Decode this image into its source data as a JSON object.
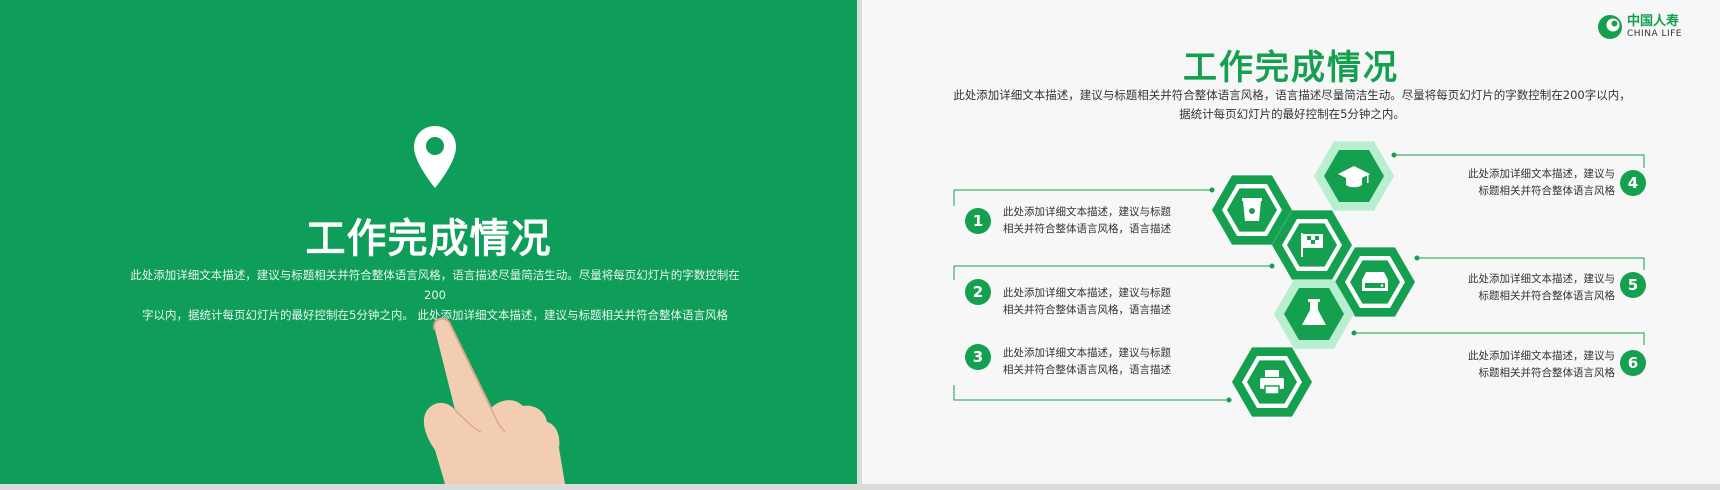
{
  "left": {
    "title": "工作完成情况",
    "desc1": "此处添加详细文本描述，建议与标题相关并符合整体语言风格，语言描述尽量简洁生动。尽量将每页幻灯片的字数控制在200",
    "desc2": "字以内，据统计每页幻灯片的最好控制在5分钟之内。  此处添加详细文本描述，建议与标题相关并符合整体语言风格"
  },
  "right": {
    "logo": {
      "cn": "中国人寿",
      "en": "CHINA LIFE"
    },
    "title": "工作完成情况",
    "desc1": "此处添加详细文本描述，建议与标题相关并符合整体语言风格，语言描述尽量简洁生动。尽量将每页幻灯片的字数控制在200字以内，",
    "desc2": "据统计每页幻灯片的最好控制在5分钟之内。",
    "items": [
      {
        "num": "1",
        "line1": "此处添加详细文本描述，建议与标题",
        "line2": "相关并符合整体语言风格，语言描述"
      },
      {
        "num": "2",
        "line1": "此处添加详细文本描述，建议与标题",
        "line2": "相关并符合整体语言风格，语言描述"
      },
      {
        "num": "3",
        "line1": "此处添加详细文本描述，建议与标题",
        "line2": "相关并符合整体语言风格，语言描述"
      },
      {
        "num": "4",
        "line1": "此处添加详细文本描述，建议与",
        "line2": "标题相关并符合整体语言风格"
      },
      {
        "num": "5",
        "line1": "此处添加详细文本描述，建议与",
        "line2": "标题相关并符合整体语言风格"
      },
      {
        "num": "6",
        "line1": "此处添加详细文本描述，建议与",
        "line2": "标题相关并符合整体语言风格"
      }
    ],
    "icons": [
      "mug-icon",
      "flag-icon",
      "printer-icon",
      "graduation-cap-icon",
      "drive-icon",
      "flask-icon"
    ]
  },
  "colors": {
    "green": "#14a04e",
    "left_bg": "#0f9d5a",
    "light_green": "#b8efd0"
  }
}
